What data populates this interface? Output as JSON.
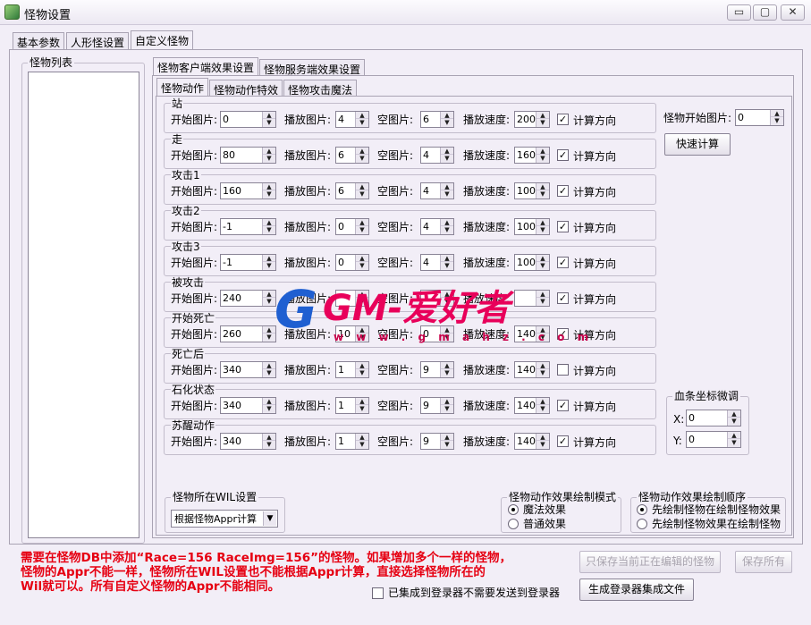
{
  "window": {
    "title": "怪物设置",
    "controls": {
      "minimize": "▭",
      "maximize": "▢",
      "close": "✕"
    }
  },
  "top_tabs": [
    {
      "label": "基本参数",
      "active": false
    },
    {
      "label": "人形怪设置",
      "active": false
    },
    {
      "label": "自定义怪物",
      "active": true
    }
  ],
  "monster_list": {
    "title": "怪物列表",
    "items": []
  },
  "effect_tabs": [
    {
      "label": "怪物客户端效果设置",
      "active": true
    },
    {
      "label": "怪物服务端效果设置",
      "active": false
    }
  ],
  "sub_tabs": [
    {
      "label": "怪物动作",
      "active": true
    },
    {
      "label": "怪物动作特效",
      "active": false
    },
    {
      "label": "怪物攻击魔法",
      "active": false
    }
  ],
  "field_labels": {
    "start": "开始图片:",
    "play": "播放图片:",
    "blank": "空图片:",
    "speed": "播放速度:",
    "calc_dir": "计算方向"
  },
  "actions": [
    {
      "name": "站",
      "start": "0",
      "play": "4",
      "blank": "6",
      "speed": "200",
      "calc": true
    },
    {
      "name": "走",
      "start": "80",
      "play": "6",
      "blank": "4",
      "speed": "160",
      "calc": true
    },
    {
      "name": "攻击1",
      "start": "160",
      "play": "6",
      "blank": "4",
      "speed": "100",
      "calc": true
    },
    {
      "name": "攻击2",
      "start": "-1",
      "play": "0",
      "blank": "4",
      "speed": "100",
      "calc": true
    },
    {
      "name": "攻击3",
      "start": "-1",
      "play": "0",
      "blank": "4",
      "speed": "100",
      "calc": true
    },
    {
      "name": "被攻击",
      "start": "240",
      "play": "",
      "blank": "",
      "speed": "",
      "calc": true
    },
    {
      "name": "开始死亡",
      "start": "260",
      "play": "10",
      "blank": "0",
      "speed": "140",
      "calc": true
    },
    {
      "name": "死亡后",
      "start": "340",
      "play": "1",
      "blank": "9",
      "speed": "140",
      "calc": false
    },
    {
      "name": "石化状态",
      "start": "340",
      "play": "1",
      "blank": "9",
      "speed": "140",
      "calc": true
    },
    {
      "name": "苏醒动作",
      "start": "340",
      "play": "1",
      "blank": "9",
      "speed": "140",
      "calc": true
    }
  ],
  "monster_start_image": {
    "label": "怪物开始图片:",
    "value": "0"
  },
  "quick_calc_button": "快速计算",
  "hp_bar_offset": {
    "title": "血条坐标微调",
    "x_label": "X:",
    "x_value": "0",
    "y_label": "Y:",
    "y_value": "0"
  },
  "wil_setting": {
    "title": "怪物所在WIL设置",
    "selected": "根据怪物Appr计算"
  },
  "draw_mode": {
    "title": "怪物动作效果绘制模式",
    "options": [
      {
        "label": "魔法效果",
        "checked": true
      },
      {
        "label": "普通效果",
        "checked": false
      }
    ]
  },
  "draw_order": {
    "title": "怪物动作效果绘制顺序",
    "options": [
      {
        "label": "先绘制怪物在绘制怪物效果",
        "checked": true
      },
      {
        "label": "先绘制怪物效果在绘制怪物",
        "checked": false
      }
    ]
  },
  "notice_lines": [
    "需要在怪物DB中添加“Race=156 RaceImg=156”的怪物。如果增加多个一样的怪物，",
    "怪物的Appr不能一样，怪物所在WIL设置也不能根据Appr计算，直接选择怪物所在的",
    "Wil就可以。所有自定义怪物的Appr不能相同。"
  ],
  "buttons": {
    "save_current": "只保存当前正在编辑的怪物",
    "save_all": "保存所有",
    "generate": "生成登录器集成文件"
  },
  "integrated_checkbox": {
    "label": "已集成到登录器不需要发送到登录器",
    "checked": false
  },
  "watermark": {
    "g": "G",
    "text": "GM-爱好者",
    "url": "w w w . g m a h z . c o m"
  },
  "colors": {
    "notice": "#e60012",
    "watermark_blue": "#1f5fd1",
    "watermark_red": "#e8005a"
  }
}
